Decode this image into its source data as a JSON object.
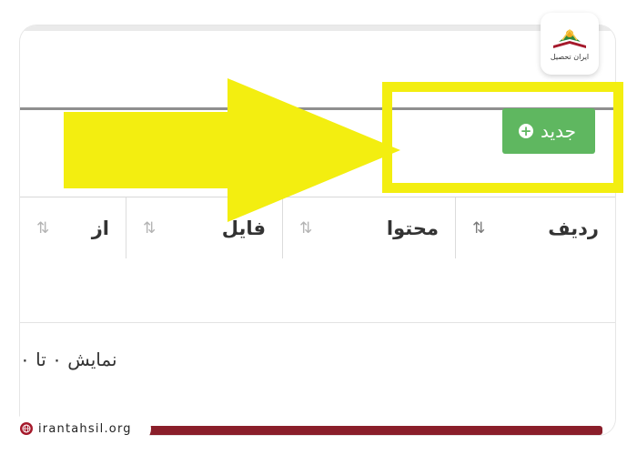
{
  "toolbar": {
    "new_label": "جدید",
    "new_icon": "plus-circle-icon",
    "new_button_color": "#5fb760"
  },
  "table": {
    "headers": [
      {
        "label": "ردیف",
        "sort_icon": "sort-active-icon"
      },
      {
        "label": "محتوا",
        "sort_icon": "sort-icon"
      },
      {
        "label": "فایل",
        "sort_icon": "sort-icon"
      },
      {
        "label": "از",
        "sort_icon": "sort-icon"
      }
    ]
  },
  "pagination": {
    "info": "نمایش ۰ تا ۰"
  },
  "overlay": {
    "highlight_color": "#f3ee10",
    "arrow_color": "#f3ee10"
  },
  "logo": {
    "text": "ایران تحصیل"
  },
  "footer": {
    "url": "irantahsil.org",
    "bar_color": "#8a1e2a"
  }
}
